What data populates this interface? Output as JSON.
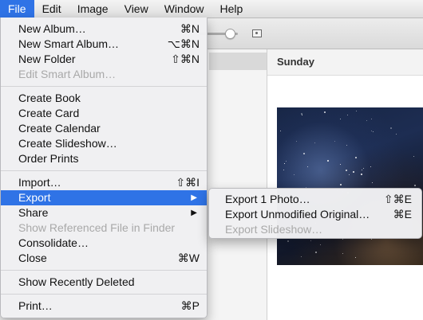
{
  "menubar": {
    "items": [
      "File",
      "Edit",
      "Image",
      "View",
      "Window",
      "Help"
    ],
    "active": "File"
  },
  "main": {
    "day_title": "Sunday",
    "photo_icon": "night-sky-photo"
  },
  "file_menu": {
    "groups": [
      [
        {
          "label": "New Album…",
          "shortcut": "⌘N",
          "enabled": true
        },
        {
          "label": "New Smart Album…",
          "shortcut": "⌥⌘N",
          "enabled": true
        },
        {
          "label": "New Folder",
          "shortcut": "⇧⌘N",
          "enabled": true
        },
        {
          "label": "Edit Smart Album…",
          "shortcut": "",
          "enabled": false
        }
      ],
      [
        {
          "label": "Create Book",
          "shortcut": "",
          "enabled": true
        },
        {
          "label": "Create Card",
          "shortcut": "",
          "enabled": true
        },
        {
          "label": "Create Calendar",
          "shortcut": "",
          "enabled": true
        },
        {
          "label": "Create Slideshow…",
          "shortcut": "",
          "enabled": true
        },
        {
          "label": "Order Prints",
          "shortcut": "",
          "enabled": true
        }
      ],
      [
        {
          "label": "Import…",
          "shortcut": "⇧⌘I",
          "enabled": true
        },
        {
          "label": "Export",
          "shortcut": "",
          "enabled": true,
          "submenu": true,
          "highlighted": true
        },
        {
          "label": "Share",
          "shortcut": "",
          "enabled": true,
          "submenu": true
        },
        {
          "label": "Show Referenced File in Finder",
          "shortcut": "",
          "enabled": false
        },
        {
          "label": "Consolidate…",
          "shortcut": "",
          "enabled": true
        },
        {
          "label": "Close",
          "shortcut": "⌘W",
          "enabled": true
        }
      ],
      [
        {
          "label": "Show Recently Deleted",
          "shortcut": "",
          "enabled": true
        }
      ],
      [
        {
          "label": "Print…",
          "shortcut": "⌘P",
          "enabled": true
        }
      ]
    ]
  },
  "export_submenu": {
    "items": [
      {
        "label": "Export 1 Photo…",
        "shortcut": "⇧⌘E",
        "enabled": true
      },
      {
        "label": "Export Unmodified Original…",
        "shortcut": "⌘E",
        "enabled": true
      },
      {
        "label": "Export Slideshow…",
        "shortcut": "",
        "enabled": false
      }
    ]
  },
  "colors": {
    "highlight": "#2f73e6",
    "disabled_text": "#a9a9a9"
  }
}
